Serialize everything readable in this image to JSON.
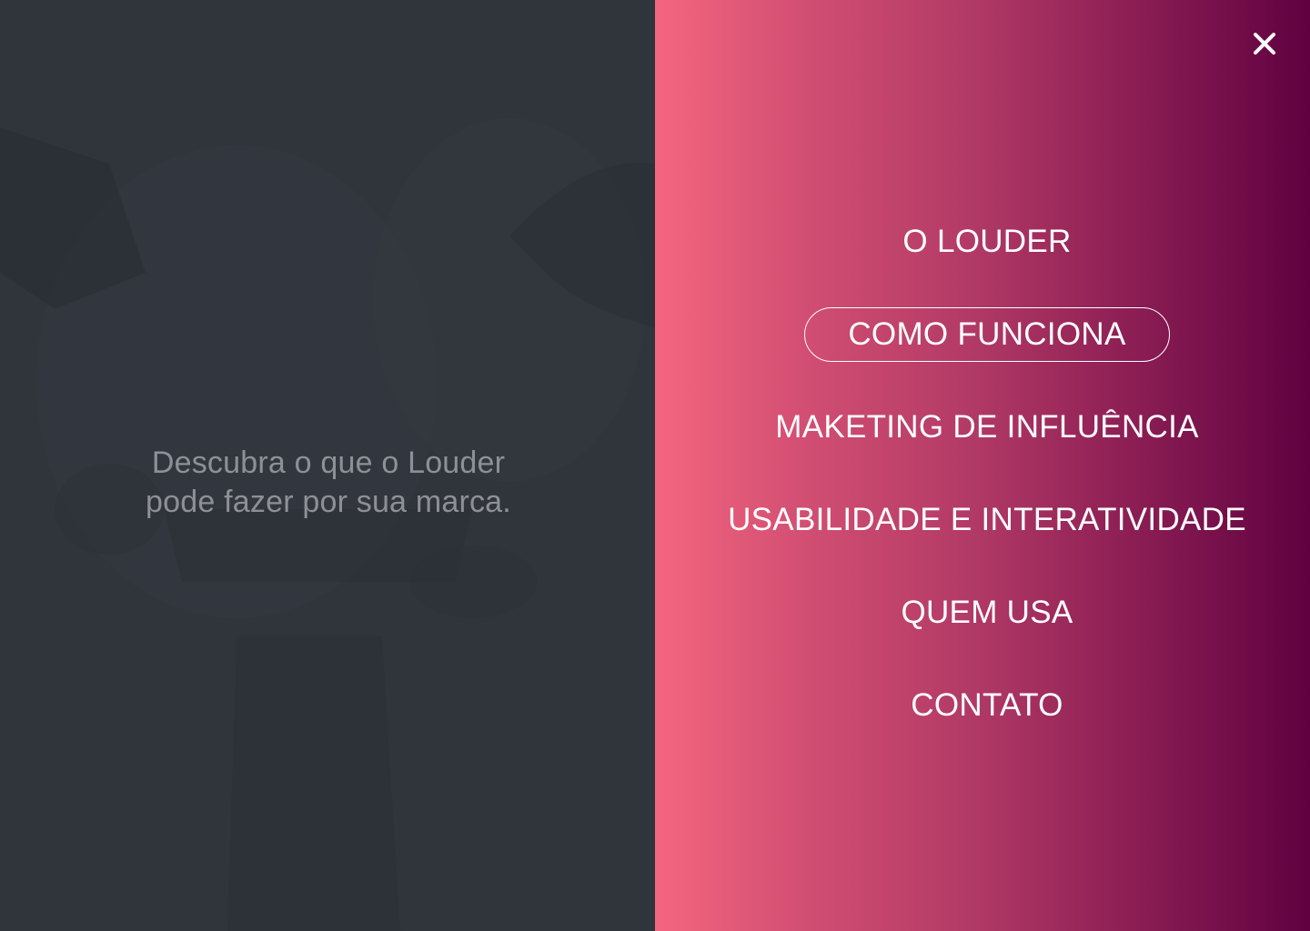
{
  "left_panel": {
    "tagline_line1": "Descubra o que o Louder",
    "tagline_line2": "pode fazer por sua marca."
  },
  "close_button": {
    "icon": "close-icon"
  },
  "menu": {
    "active_index": 1,
    "items": [
      {
        "label": "O LOUDER"
      },
      {
        "label": "COMO FUNCIONA"
      },
      {
        "label": "MAKETING DE INFLUÊNCIA"
      },
      {
        "label": "USABILIDADE E INTERATIVIDADE"
      },
      {
        "label": "QUEM USA"
      },
      {
        "label": "CONTATO"
      }
    ]
  },
  "colors": {
    "left_bg": "#2b2f35",
    "gradient_start": "#f4667f",
    "gradient_end": "#600140",
    "menu_text": "#ffffff",
    "tagline_text": "#8d9096"
  }
}
